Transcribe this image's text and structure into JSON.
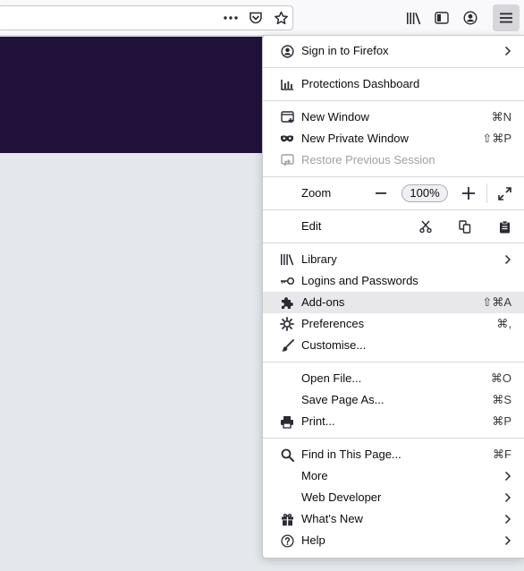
{
  "toolbar": {
    "icons": [
      "more-dots-icon",
      "pocket-icon",
      "bookmark-star-icon",
      "library-icon",
      "sidebar-icon",
      "account-icon",
      "hamburger-menu-icon"
    ]
  },
  "menu": {
    "sign_in": "Sign in to Firefox",
    "protections": "Protections Dashboard",
    "new_window": {
      "label": "New Window",
      "shortcut": "⌘N"
    },
    "new_private": {
      "label": "New Private Window",
      "shortcut": "⇧⌘P"
    },
    "restore": "Restore Previous Session",
    "zoom": {
      "label": "Zoom",
      "minus": "−",
      "value": "100%",
      "plus": "+"
    },
    "edit": "Edit",
    "library": "Library",
    "logins": "Logins and Passwords",
    "addons": {
      "label": "Add-ons",
      "shortcut": "⇧⌘A"
    },
    "preferences": {
      "label": "Preferences",
      "shortcut": "⌘,"
    },
    "customise": "Customise...",
    "open_file": {
      "label": "Open File...",
      "shortcut": "⌘O"
    },
    "save_page": {
      "label": "Save Page As...",
      "shortcut": "⌘S"
    },
    "print": {
      "label": "Print...",
      "shortcut": "⌘P"
    },
    "find": {
      "label": "Find in This Page...",
      "shortcut": "⌘F"
    },
    "more": "More",
    "web_developer": "Web Developer",
    "whats_new": "What's New",
    "help": "Help"
  },
  "colors": {
    "banner": "#20123a",
    "page_background": "#e4e7eb",
    "toolbar": "#f9f9fb",
    "hover_row": "#e8e8ea"
  }
}
